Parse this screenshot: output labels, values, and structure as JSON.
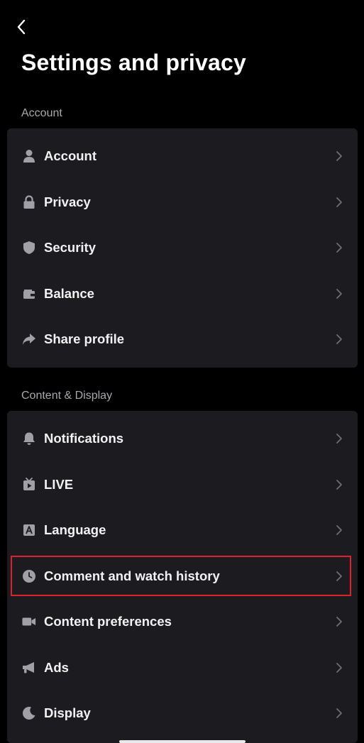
{
  "header": {
    "title": "Settings and privacy",
    "back_icon": "chevron-left-icon"
  },
  "sections": [
    {
      "label": "Account",
      "items": [
        {
          "label": "Account",
          "icon": "person-icon"
        },
        {
          "label": "Privacy",
          "icon": "lock-icon"
        },
        {
          "label": "Security",
          "icon": "shield-icon"
        },
        {
          "label": "Balance",
          "icon": "wallet-icon"
        },
        {
          "label": "Share profile",
          "icon": "share-arrow-icon"
        }
      ]
    },
    {
      "label": "Content & Display",
      "items": [
        {
          "label": "Notifications",
          "icon": "bell-icon"
        },
        {
          "label": "LIVE",
          "icon": "live-tv-icon"
        },
        {
          "label": "Language",
          "icon": "language-a-icon"
        },
        {
          "label": "Comment and watch history",
          "icon": "clock-icon",
          "highlighted": true
        },
        {
          "label": "Content preferences",
          "icon": "video-camera-icon"
        },
        {
          "label": "Ads",
          "icon": "megaphone-icon"
        },
        {
          "label": "Display",
          "icon": "moon-icon"
        }
      ]
    }
  ],
  "colors": {
    "background": "#000000",
    "card": "#1c1c20",
    "section_label": "#a8a8ad",
    "icon": "#a0a0a6",
    "chevron": "#6e6e74",
    "highlight": "#e0202a"
  }
}
